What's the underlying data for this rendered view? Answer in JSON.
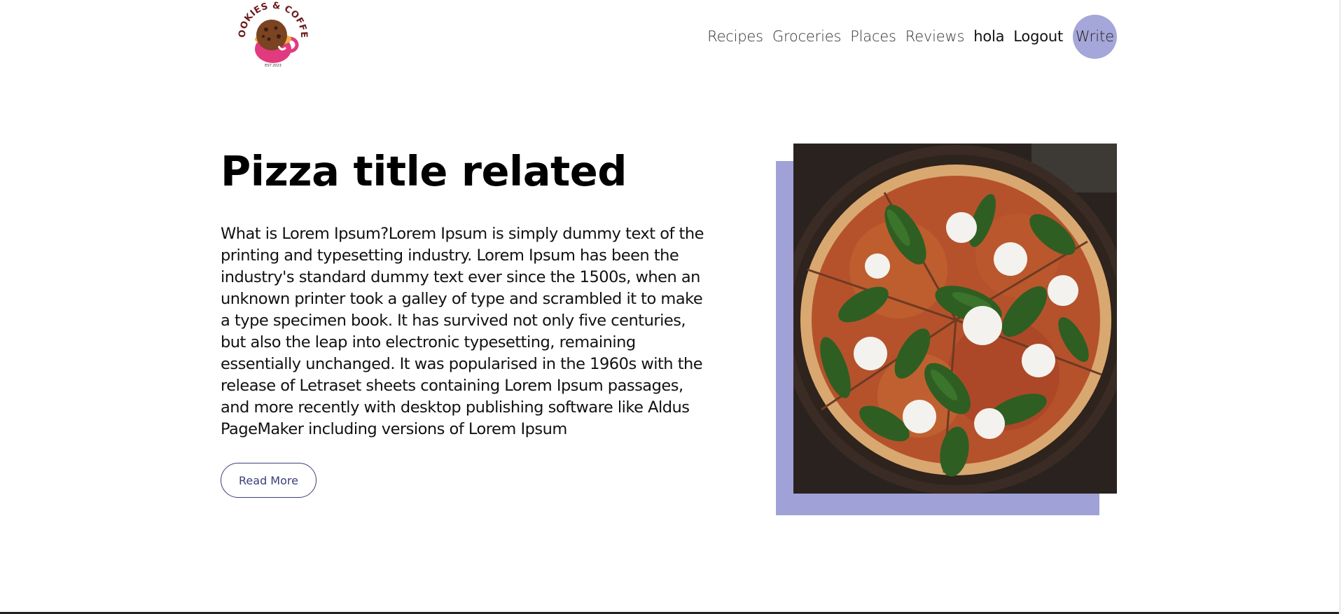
{
  "header": {
    "logo_text": "COOKIES & COFFEE",
    "logo_est": "EST 2023",
    "nav": [
      {
        "label": "Recipes"
      },
      {
        "label": "Groceries"
      },
      {
        "label": "Places"
      },
      {
        "label": "Reviews"
      },
      {
        "label": "hola"
      },
      {
        "label": "Logout"
      }
    ],
    "write_label": "Write"
  },
  "hero": {
    "title": "Pizza title related",
    "description": "What is Lorem Ipsum?Lorem Ipsum is simply dummy text of the printing and typesetting industry. Lorem Ipsum has been the industry's standard dummy text ever since the 1500s, when an unknown printer took a galley of type and scrambled it to make a type specimen book. It has survived not only five centuries, but also the leap into electronic typesetting, remaining essentially unchanged. It was popularised in the 1960s with the release of Letraset sheets containing Lorem Ipsum passages, and more recently with desktop publishing software like Aldus PageMaker including versions of Lorem Ipsum",
    "read_more_label": "Read More",
    "image_icon": "pizza-photo"
  },
  "colors": {
    "accent": "#a5a6d9",
    "button_border": "#3b3f7a"
  }
}
